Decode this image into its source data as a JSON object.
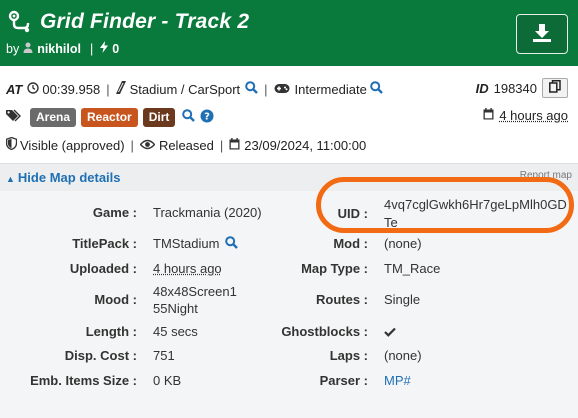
{
  "header": {
    "title": "Grid Finder - Track 2",
    "by_label": "by",
    "author": "nikhilol",
    "awards": "0",
    "download_icon": "download-icon"
  },
  "summary": {
    "at_label": "AT",
    "author_time": "00:39.958",
    "environment": "Stadium / CarSport",
    "difficulty": "Intermediate",
    "id_label": "ID",
    "id_value": "198340"
  },
  "tags": [
    {
      "label": "Arena",
      "color": "#6b6b6b"
    },
    {
      "label": "Reactor",
      "color": "#c8551e"
    },
    {
      "label": "Dirt",
      "color": "#6b3a1e"
    }
  ],
  "age": "4 hours ago",
  "status": {
    "visibility": "Visible (approved)",
    "release": "Released",
    "date": "23/09/2024, 11:00:00"
  },
  "details": {
    "toggle_label": "Hide Map details",
    "right_link": "Report map",
    "left": [
      {
        "label": "Game :",
        "value": "Trackmania (2020)"
      },
      {
        "label": "TitlePack :",
        "value": "TMStadium"
      },
      {
        "label": "Uploaded :",
        "value": "4 hours ago"
      },
      {
        "label": "Mood :",
        "value": "48x48Screen155Night"
      },
      {
        "label": "Length :",
        "value": "45 secs"
      },
      {
        "label": "Disp. Cost :",
        "value": "751"
      },
      {
        "label": "Emb. Items Size :",
        "value": "0 KB"
      }
    ],
    "right": [
      {
        "label": "UID :",
        "value": "4vq7cglGwkh6Hr7geLpMlh0GDTe"
      },
      {
        "label": "Mod :",
        "value": "(none)"
      },
      {
        "label": "Map Type :",
        "value": "TM_Race"
      },
      {
        "label": "Routes :",
        "value": "Single"
      },
      {
        "label": "Ghostblocks :",
        "value": "check-icon"
      },
      {
        "label": "Laps :",
        "value": "(none)"
      },
      {
        "label": "Parser :",
        "value": "MP#"
      }
    ]
  },
  "colors": {
    "header_bg": "#0a7a3c",
    "link": "#1f6fb3",
    "highlight": "#f26a14"
  }
}
